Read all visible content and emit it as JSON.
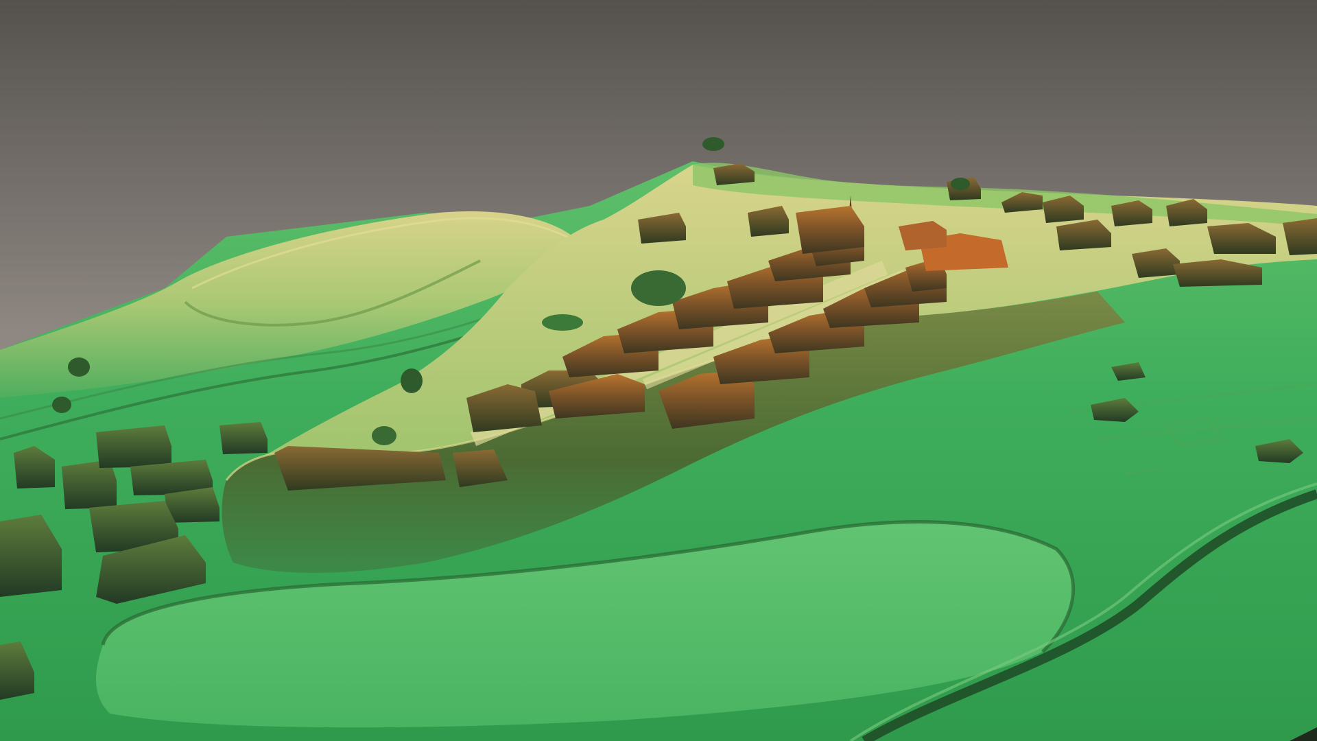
{
  "scene": {
    "subject": "lidar-elevation-relief",
    "colors": {
      "sky_top": "#56534f",
      "sky_mid": "#8e8782",
      "sky_bottom": "#a7a19c",
      "low_ground": "#3aa85a",
      "mid_ground": "#8cc066",
      "high_ground": "#d6d48a",
      "ridge_shadow": "#2c5a2e",
      "roof_dark": "#4a3a22",
      "roof_mid": "#8a5a2c",
      "roof_high": "#c06a2a",
      "edge_dark": "#1d2a1c"
    }
  }
}
